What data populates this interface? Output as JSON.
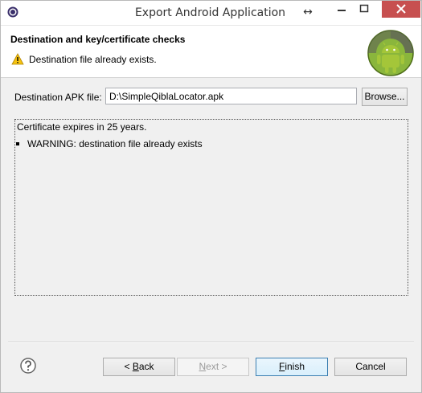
{
  "window": {
    "title": "Export Android Application",
    "icons": {
      "app": "eclipse-icon",
      "resize": "resize-arrows-icon",
      "minimize": "minimize-icon",
      "maximize": "maximize-icon",
      "close": "close-icon"
    }
  },
  "header": {
    "title": "Destination and key/certificate checks",
    "message": "Destination file already exists.",
    "message_icon": "warning-icon",
    "logo": "android-logo"
  },
  "form": {
    "dest_label": "Destination APK file:",
    "dest_value": "D:\\SimpleQiblaLocator.apk",
    "browse_label": "Browse..."
  },
  "log": {
    "line1": "Certificate expires in 25 years.",
    "line2": "WARNING: destination file already exists"
  },
  "buttons": {
    "help_icon": "help-icon",
    "back": {
      "prefix": "< ",
      "mnemonic": "B",
      "rest": "ack"
    },
    "next": {
      "mnemonic": "N",
      "rest": "ext >"
    },
    "finish": {
      "mnemonic": "F",
      "rest": "inish"
    },
    "cancel": "Cancel"
  },
  "colors": {
    "close_button": "#c75050",
    "default_button_border": "#3c7fb1",
    "android_green": "#a4c639"
  }
}
